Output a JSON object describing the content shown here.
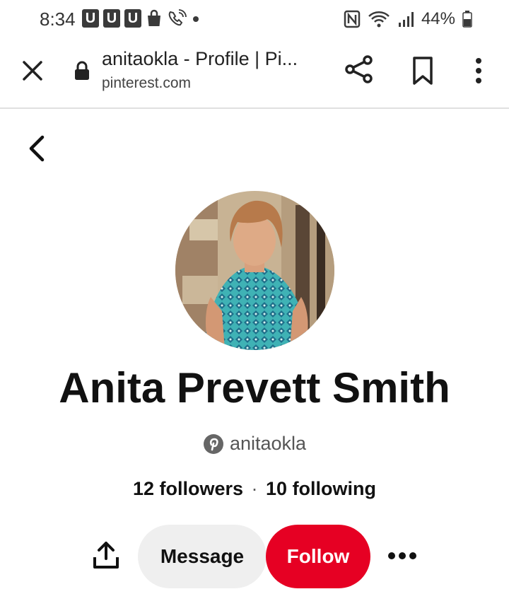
{
  "status_bar": {
    "time": "8:34",
    "u_badge": "U",
    "battery": "44%",
    "icons": [
      "u-badge-icon",
      "shopping-bag-icon",
      "wifi-call-icon",
      "dot-icon",
      "nfc-icon",
      "wifi-icon",
      "signal-icon",
      "battery-icon"
    ]
  },
  "browser": {
    "title": "anitaokla - Profile | Pi...",
    "domain": "pinterest.com",
    "icons": [
      "close-icon",
      "lock-icon",
      "share-icon",
      "bookmark-icon",
      "more-vert-icon"
    ]
  },
  "profile": {
    "name": "Anita Prevett Smith",
    "handle": "anitaokla",
    "followers": "12 followers",
    "separator": "·",
    "following": "10 following"
  },
  "actions": {
    "message_label": "Message",
    "follow_label": "Follow",
    "icons": [
      "back-chevron-icon",
      "pinterest-logo-icon",
      "upload-share-icon",
      "more-horiz-icon"
    ]
  },
  "colors": {
    "follow_red": "#e60023",
    "message_gray": "#efefef",
    "text_dark": "#111111"
  }
}
